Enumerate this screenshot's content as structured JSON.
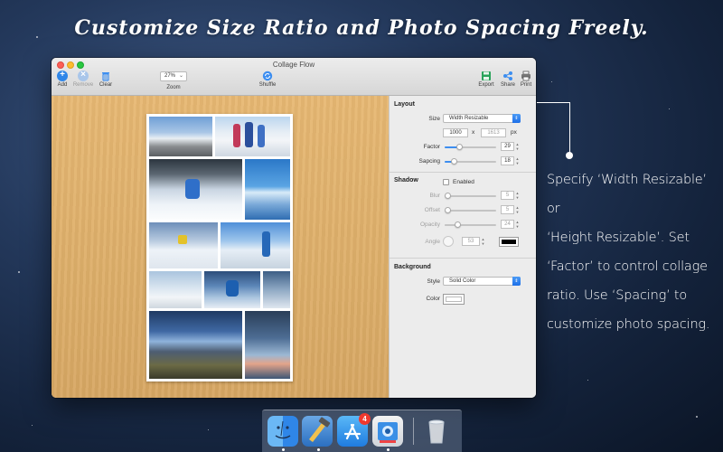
{
  "headline": "Customize Size Ratio and Photo Spacing Freely.",
  "window": {
    "title": "Collage Flow",
    "toolbar": {
      "add_label": "Add",
      "remove_label": "Remove",
      "clear_label": "Clear",
      "zoom_value": "27%",
      "zoom_label": "Zoom",
      "shuffle_label": "Shuffle",
      "export_label": "Export",
      "share_label": "Share",
      "print_label": "Print"
    }
  },
  "inspector": {
    "layout": {
      "title": "Layout",
      "size_label": "Size",
      "size_value": "Width Resizable",
      "width_value": "1000",
      "times": "x",
      "height_value": "1613",
      "unit": "px",
      "factor_label": "Factor",
      "factor_value": "29",
      "factor_level": 0.28,
      "spacing_label": "Sapcing",
      "spacing_value": "18",
      "spacing_level": 0.18
    },
    "shadow": {
      "title": "Shadow",
      "enabled_label": "Enabled",
      "enabled": false,
      "blur_label": "Blur",
      "blur_value": "5",
      "blur_level": 0.05,
      "offset_label": "Offset",
      "offset_value": "5",
      "offset_level": 0.05,
      "opacity_label": "Opacity",
      "opacity_value": "24",
      "opacity_level": 0.24,
      "angle_label": "Angle",
      "angle_value": "53",
      "shadow_color": "#000000"
    },
    "background": {
      "title": "Background",
      "style_label": "Style",
      "style_value": "Solid Color",
      "color_label": "Color",
      "color_value": "#ffffff"
    }
  },
  "callout": {
    "lines": [
      "Specify ‘Width Resizable’ or",
      "‘Height Resizable’. Set",
      "‘Factor’ to control collage",
      "ratio. Use ‘Spacing’ to",
      "customize photo spacing."
    ]
  },
  "dock": {
    "apps": [
      {
        "name": "finder-icon"
      },
      {
        "name": "xcode-icon"
      },
      {
        "name": "app-store-icon",
        "badge": "4"
      },
      {
        "name": "collage-flow-icon"
      },
      {
        "name": "trash-icon"
      }
    ]
  },
  "colors": {
    "accent": "#3d8ef0",
    "canvas_wood": "#ddae69",
    "callout_text": "#ffffff"
  }
}
